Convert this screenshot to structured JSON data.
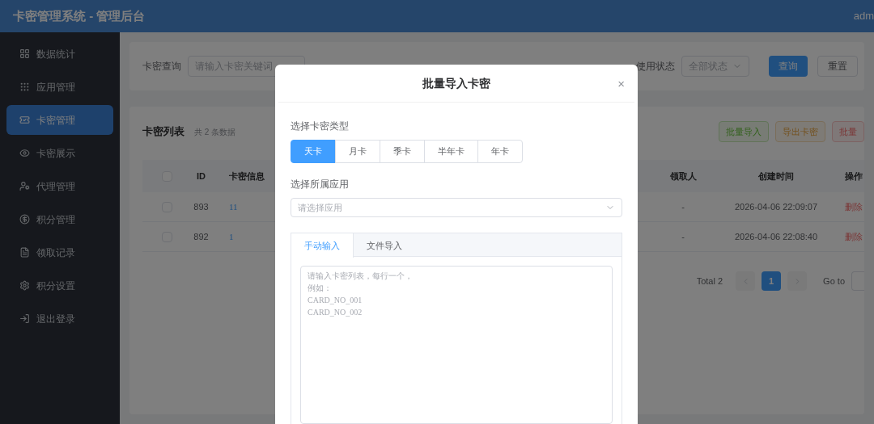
{
  "header": {
    "title": "卡密管理系统 - 管理后台",
    "user": "adm"
  },
  "sidebar": {
    "items": [
      {
        "label": "数据统计",
        "selected": false
      },
      {
        "label": "应用管理",
        "selected": false
      },
      {
        "label": "卡密管理",
        "selected": true
      },
      {
        "label": "卡密展示",
        "selected": false
      },
      {
        "label": "代理管理",
        "selected": false
      },
      {
        "label": "积分管理",
        "selected": false
      },
      {
        "label": "领取记录",
        "selected": false
      },
      {
        "label": "积分设置",
        "selected": false
      },
      {
        "label": "退出登录",
        "selected": false
      }
    ]
  },
  "filters": {
    "query_label": "卡密查询",
    "query_placeholder": "请输入卡密关键词",
    "status_label": "使用状态",
    "status_placeholder": "全部状态",
    "search_button": "查询",
    "reset_button": "重置"
  },
  "list": {
    "title": "卡密列表",
    "count": "共 2 条数据",
    "actions": [
      {
        "label": "批量导入",
        "kind": "success"
      },
      {
        "label": "导出卡密",
        "kind": "warning"
      },
      {
        "label": "批量",
        "kind": "danger"
      }
    ],
    "all_checked": false,
    "columns": {
      "left": [
        "ID",
        "卡密信息"
      ],
      "right": [
        "领取人",
        "创建时间",
        "操作"
      ]
    },
    "rows": [
      {
        "checked": false,
        "id": "893",
        "info": "11",
        "receiver": "-",
        "created": "2026-04-06 22:09:07",
        "action": "删除"
      },
      {
        "checked": false,
        "id": "892",
        "info": "1",
        "receiver": "-",
        "created": "2026-04-06 22:08:40",
        "action": "删除"
      }
    ]
  },
  "pagination": {
    "total": "Total 2",
    "pages": [
      {
        "label": "1",
        "selected": true
      }
    ],
    "goto": "Go to"
  },
  "dialog": {
    "title": "批量导入卡密",
    "close": "×",
    "type_label": "选择卡密类型",
    "types": [
      {
        "label": "天卡",
        "selected": true
      },
      {
        "label": "月卡",
        "selected": false
      },
      {
        "label": "季卡",
        "selected": false
      },
      {
        "label": "半年卡",
        "selected": false
      },
      {
        "label": "年卡",
        "selected": false
      }
    ],
    "app_label": "选择所属应用",
    "app_placeholder": "请选择应用",
    "tabs": [
      {
        "label": "手动输入",
        "selected": true
      },
      {
        "label": "文件导入",
        "selected": false
      }
    ],
    "placeholder_lines": [
      "请输入卡密列表，每行一个，",
      "例如：",
      "CARD_NO_001",
      "CARD_NO_002"
    ]
  }
}
